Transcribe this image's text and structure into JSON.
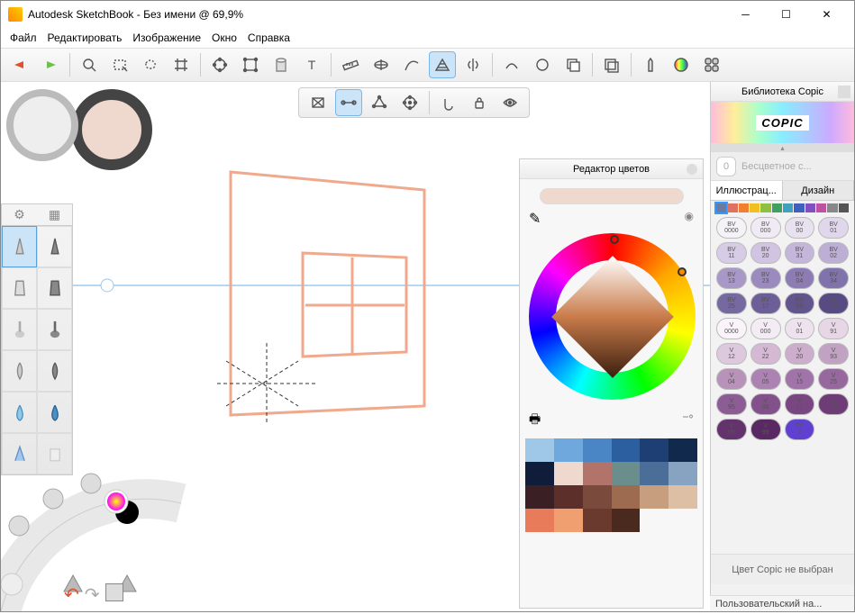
{
  "window": {
    "app_name": "Autodesk SketchBook",
    "doc_title": "Без имени @ 69,9%"
  },
  "menu": [
    "Файл",
    "Редактировать",
    "Изображение",
    "Окно",
    "Справка"
  ],
  "toolbar_icons": [
    "undo",
    "redo",
    "zoom",
    "select-rect",
    "select-lasso",
    "crop",
    "transform-free",
    "distort",
    "bucket",
    "text",
    "ruler",
    "ellipse-guide",
    "french-curve",
    "perspective",
    "symmetry",
    "predictive-stroke",
    "steady-stroke",
    "layers",
    "add-image",
    "brush-puck",
    "color-puck",
    "ui-toggle"
  ],
  "perspective_icons": [
    "persp-1pt",
    "persp-2pt",
    "persp-3pt",
    "persp-fisheye",
    "snap",
    "lock",
    "visibility"
  ],
  "perspective_selected": 1,
  "toolbar_selected": 13,
  "color_editor": {
    "title": "Редактор цветов",
    "current": "#efd9ce",
    "palette": [
      "#9fc7e8",
      "#6fa8dc",
      "#4a86c6",
      "#2b5fa0",
      "#1d3f73",
      "#10294c",
      "#0f1d3b",
      "#efd9ce",
      "#b1736a",
      "#6a8e8b",
      "#4a6e97",
      "#86a4c2",
      "#3a1f24",
      "#5c2f2b",
      "#7a4a3c",
      "#9c6b50",
      "#c79e7e",
      "#dcbfa4",
      "#e87b5a",
      "#f0a070",
      "#6a3a2f",
      "#4a2a1f",
      "",
      ""
    ]
  },
  "copic": {
    "title": "Библиотека Copic",
    "brand": "COPIC",
    "selected_num": "0",
    "selected_name": "Бесцветное с...",
    "tabs": [
      "Иллюстрац...",
      "Дизайн"
    ],
    "active_tab": 0,
    "hue_strip": [
      "#6a7aa0",
      "#e07060",
      "#f08030",
      "#f0c020",
      "#90c040",
      "#40a060",
      "#40a0c0",
      "#4060c0",
      "#8050c0",
      "#c050a0",
      "#888888",
      "#555555"
    ],
    "chips": [
      {
        "code": "BV",
        "num": "0000",
        "bg": "#f5f3f8"
      },
      {
        "code": "BV",
        "num": "000",
        "bg": "#efeaf4"
      },
      {
        "code": "BV",
        "num": "00",
        "bg": "#e8e1f0"
      },
      {
        "code": "BV",
        "num": "01",
        "bg": "#e0d7ec"
      },
      {
        "code": "BV",
        "num": "11",
        "bg": "#d6cce6"
      },
      {
        "code": "BV",
        "num": "20",
        "bg": "#d0c4e2"
      },
      {
        "code": "BV",
        "num": "31",
        "bg": "#c4b6da"
      },
      {
        "code": "BV",
        "num": "02",
        "bg": "#bcaed4"
      },
      {
        "code": "BV",
        "num": "13",
        "bg": "#a898c8"
      },
      {
        "code": "BV",
        "num": "23",
        "bg": "#9a8abe"
      },
      {
        "code": "BV",
        "num": "04",
        "bg": "#8d7cb4"
      },
      {
        "code": "BV",
        "num": "34",
        "bg": "#8072aa"
      },
      {
        "code": "BV",
        "num": "25",
        "bg": "#7668a0"
      },
      {
        "code": "BV",
        "num": "17",
        "bg": "#6c5e96"
      },
      {
        "code": "BV",
        "num": "08",
        "bg": "#62548c"
      },
      {
        "code": "BV",
        "num": "29",
        "bg": "#584a82"
      },
      {
        "code": "V",
        "num": "0000",
        "bg": "#faf4fa"
      },
      {
        "code": "V",
        "num": "000",
        "bg": "#f4ecf4"
      },
      {
        "code": "V",
        "num": "01",
        "bg": "#eee2ee"
      },
      {
        "code": "V",
        "num": "91",
        "bg": "#e6d6e6"
      },
      {
        "code": "V",
        "num": "12",
        "bg": "#dec8de"
      },
      {
        "code": "V",
        "num": "22",
        "bg": "#d4b8d4"
      },
      {
        "code": "V",
        "num": "20",
        "bg": "#ccaecc"
      },
      {
        "code": "V",
        "num": "93",
        "bg": "#c2a2c2"
      },
      {
        "code": "V",
        "num": "04",
        "bg": "#b892b8"
      },
      {
        "code": "V",
        "num": "05",
        "bg": "#ac82b2"
      },
      {
        "code": "V",
        "num": "15",
        "bg": "#a074a8"
      },
      {
        "code": "V",
        "num": "25",
        "bg": "#96689e"
      },
      {
        "code": "V",
        "num": "95",
        "bg": "#8c5c94"
      },
      {
        "code": "V",
        "num": "06",
        "bg": "#82508a"
      },
      {
        "code": "V",
        "num": "17",
        "bg": "#784680"
      },
      {
        "code": "V",
        "num": "28",
        "bg": "#6e3c76"
      },
      {
        "code": "V",
        "num": "09",
        "bg": "#64326c"
      },
      {
        "code": "V",
        "num": "99",
        "bg": "#5a2862"
      },
      {
        "code": "FV",
        "num": "2",
        "bg": "#6040d0"
      }
    ],
    "footer": "Цвет Copic не выбран",
    "userset": "Пользовательский на..."
  }
}
